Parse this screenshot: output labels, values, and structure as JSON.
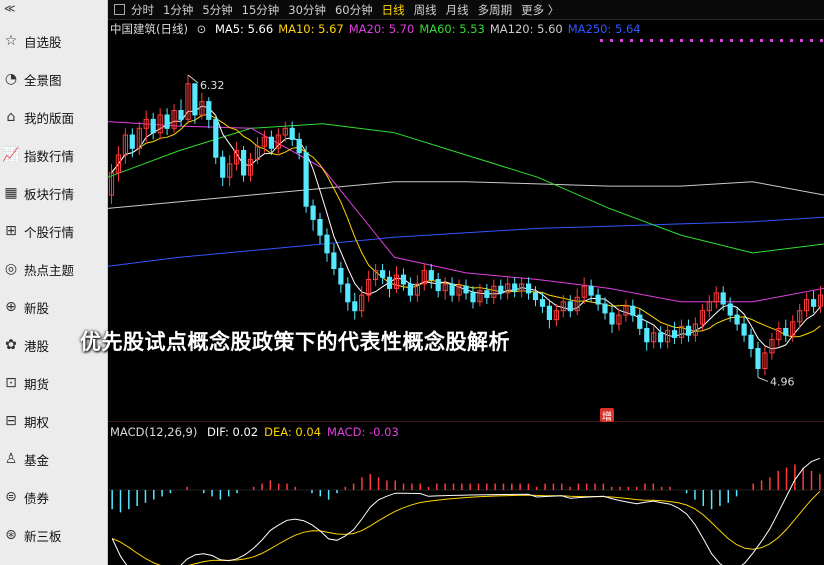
{
  "sidebar": {
    "collapse_icon": "double-chevron-left-icon",
    "items": [
      {
        "label": "自选股",
        "icon": "star-icon"
      },
      {
        "label": "全景图",
        "icon": "pie-chart-icon"
      },
      {
        "label": "我的版面",
        "icon": "home-icon"
      },
      {
        "label": "指数行情",
        "icon": "line-chart-icon"
      },
      {
        "label": "板块行情",
        "icon": "grid-icon"
      },
      {
        "label": "个股行情",
        "icon": "person-chart-icon"
      },
      {
        "label": "热点主题",
        "icon": "target-icon"
      },
      {
        "label": "新股",
        "icon": "new-stock-icon"
      },
      {
        "label": "港股",
        "icon": "bauhinia-icon"
      },
      {
        "label": "期货",
        "icon": "futures-chart-icon"
      },
      {
        "label": "期权",
        "icon": "options-chart-icon"
      },
      {
        "label": "基金",
        "icon": "fund-icon"
      },
      {
        "label": "债券",
        "icon": "bond-icon"
      },
      {
        "label": "新三板",
        "icon": "neeq-icon"
      }
    ]
  },
  "toolbar": {
    "tabs": [
      "分时",
      "1分钟",
      "5分钟",
      "15分钟",
      "30分钟",
      "60分钟",
      "日线",
      "周线",
      "月线",
      "多周期",
      "更多 〉"
    ],
    "active_tab": "日线"
  },
  "legend": {
    "stock": "中国建筑(日线)",
    "items": [
      {
        "text": "MA5: 5.66",
        "color": "#ffffff"
      },
      {
        "text": "MA10: 5.67",
        "color": "#ffd400"
      },
      {
        "text": "MA20: 5.70",
        "color": "#e040e0"
      },
      {
        "text": "MA60: 5.53",
        "color": "#33dd33"
      },
      {
        "text": "MA120: 5.60",
        "color": "#cccccc"
      },
      {
        "text": "MA250: 5.64",
        "color": "#3355ff"
      }
    ]
  },
  "macd_legend": {
    "label": "MACD(12,26,9)",
    "items": [
      {
        "text": "DIF: 0.02",
        "color": "#ffffff"
      },
      {
        "text": "DEA: 0.04",
        "color": "#ffd400"
      },
      {
        "text": "MACD: -0.03",
        "color": "#e040e0"
      }
    ]
  },
  "annotations": {
    "high_label": "6.32",
    "low_label": "4.96",
    "badge": "增"
  },
  "overlay_title": "优先股试点概念股政策下的代表性概念股解析",
  "colors": {
    "up": "#ff3b3b",
    "down": "#55e8ff",
    "background": "#000000",
    "active_tab": "#ffd400"
  },
  "chart_data": {
    "type": "candlestick",
    "ylim": [
      4.8,
      6.45
    ],
    "high": 6.32,
    "low": 4.96,
    "candles": [
      [
        5.78,
        5.88,
        5.74,
        5.92
      ],
      [
        5.88,
        5.96,
        5.84,
        6.0
      ],
      [
        5.96,
        6.05,
        5.92,
        6.08
      ],
      [
        6.05,
        5.99,
        5.95,
        6.08
      ],
      [
        5.99,
        6.08,
        5.96,
        6.11
      ],
      [
        6.08,
        6.12,
        6.02,
        6.16
      ],
      [
        6.12,
        6.06,
        6.03,
        6.15
      ],
      [
        6.06,
        6.14,
        6.03,
        6.17
      ],
      [
        6.14,
        6.08,
        6.05,
        6.17
      ],
      [
        6.08,
        6.16,
        6.06,
        6.19
      ],
      [
        6.16,
        6.12,
        6.09,
        6.21
      ],
      [
        6.12,
        6.28,
        6.1,
        6.32
      ],
      [
        6.28,
        6.14,
        6.1,
        6.28
      ],
      [
        6.14,
        6.2,
        6.12,
        6.24
      ],
      [
        6.2,
        6.12,
        6.08,
        6.22
      ],
      [
        6.12,
        5.95,
        5.92,
        6.14
      ],
      [
        5.95,
        5.86,
        5.82,
        5.98
      ],
      [
        5.86,
        5.92,
        5.82,
        5.96
      ],
      [
        5.92,
        5.98,
        5.89,
        6.02
      ],
      [
        5.98,
        5.87,
        5.84,
        6.0
      ],
      [
        5.87,
        5.94,
        5.84,
        5.97
      ],
      [
        5.94,
        6.0,
        5.92,
        6.04
      ],
      [
        6.0,
        6.04,
        5.97,
        6.07
      ],
      [
        6.04,
        5.99,
        5.96,
        6.07
      ],
      [
        5.99,
        6.05,
        5.96,
        6.08
      ],
      [
        6.05,
        6.08,
        6.02,
        6.11
      ],
      [
        6.08,
        6.03,
        6.0,
        6.11
      ],
      [
        6.03,
        5.97,
        5.94,
        6.06
      ],
      [
        5.97,
        5.73,
        5.7,
        6.0
      ],
      [
        5.73,
        5.67,
        5.62,
        5.76
      ],
      [
        5.67,
        5.6,
        5.56,
        5.7
      ],
      [
        5.6,
        5.52,
        5.48,
        5.63
      ],
      [
        5.52,
        5.45,
        5.42,
        5.56
      ],
      [
        5.45,
        5.38,
        5.34,
        5.48
      ],
      [
        5.38,
        5.3,
        5.26,
        5.41
      ],
      [
        5.3,
        5.26,
        5.22,
        5.34
      ],
      [
        5.26,
        5.33,
        5.23,
        5.37
      ],
      [
        5.33,
        5.4,
        5.3,
        5.44
      ],
      [
        5.4,
        5.44,
        5.37,
        5.47
      ],
      [
        5.44,
        5.41,
        5.38,
        5.47
      ],
      [
        5.41,
        5.36,
        5.32,
        5.44
      ],
      [
        5.36,
        5.42,
        5.34,
        5.46
      ],
      [
        5.42,
        5.38,
        5.35,
        5.45
      ],
      [
        5.38,
        5.33,
        5.3,
        5.41
      ],
      [
        5.33,
        5.38,
        5.3,
        5.42
      ],
      [
        5.38,
        5.44,
        5.35,
        5.47
      ],
      [
        5.44,
        5.4,
        5.36,
        5.47
      ],
      [
        5.4,
        5.35,
        5.32,
        5.43
      ],
      [
        5.35,
        5.38,
        5.31,
        5.41
      ],
      [
        5.38,
        5.33,
        5.3,
        5.41
      ],
      [
        5.33,
        5.37,
        5.3,
        5.4
      ],
      [
        5.37,
        5.34,
        5.31,
        5.4
      ],
      [
        5.34,
        5.3,
        5.27,
        5.37
      ],
      [
        5.3,
        5.35,
        5.28,
        5.38
      ],
      [
        5.35,
        5.32,
        5.29,
        5.38
      ],
      [
        5.32,
        5.37,
        5.29,
        5.4
      ],
      [
        5.37,
        5.34,
        5.31,
        5.4
      ],
      [
        5.34,
        5.38,
        5.31,
        5.41
      ],
      [
        5.38,
        5.35,
        5.32,
        5.41
      ],
      [
        5.35,
        5.38,
        5.32,
        5.41
      ],
      [
        5.38,
        5.34,
        5.31,
        5.41
      ],
      [
        5.34,
        5.31,
        5.28,
        5.37
      ],
      [
        5.31,
        5.28,
        5.25,
        5.34
      ],
      [
        5.28,
        5.22,
        5.18,
        5.31
      ],
      [
        5.22,
        5.26,
        5.19,
        5.29
      ],
      [
        5.26,
        5.3,
        5.23,
        5.33
      ],
      [
        5.3,
        5.26,
        5.23,
        5.33
      ],
      [
        5.26,
        5.32,
        5.24,
        5.36
      ],
      [
        5.32,
        5.37,
        5.29,
        5.41
      ],
      [
        5.37,
        5.33,
        5.3,
        5.4
      ],
      [
        5.33,
        5.29,
        5.26,
        5.36
      ],
      [
        5.29,
        5.25,
        5.22,
        5.32
      ],
      [
        5.25,
        5.2,
        5.16,
        5.28
      ],
      [
        5.2,
        5.24,
        5.17,
        5.27
      ],
      [
        5.24,
        5.28,
        5.21,
        5.31
      ],
      [
        5.28,
        5.24,
        5.21,
        5.31
      ],
      [
        5.24,
        5.18,
        5.15,
        5.27
      ],
      [
        5.18,
        5.12,
        5.08,
        5.21
      ],
      [
        5.12,
        5.16,
        5.09,
        5.19
      ],
      [
        5.16,
        5.12,
        5.09,
        5.19
      ],
      [
        5.12,
        5.17,
        5.09,
        5.2
      ],
      [
        5.17,
        5.14,
        5.11,
        5.21
      ],
      [
        5.14,
        5.19,
        5.11,
        5.22
      ],
      [
        5.19,
        5.15,
        5.12,
        5.22
      ],
      [
        5.15,
        5.2,
        5.12,
        5.23
      ],
      [
        5.2,
        5.26,
        5.17,
        5.29
      ],
      [
        5.26,
        5.3,
        5.23,
        5.33
      ],
      [
        5.3,
        5.34,
        5.27,
        5.37
      ],
      [
        5.34,
        5.29,
        5.26,
        5.37
      ],
      [
        5.29,
        5.24,
        5.21,
        5.32
      ],
      [
        5.24,
        5.2,
        5.17,
        5.27
      ],
      [
        5.2,
        5.15,
        5.12,
        5.23
      ],
      [
        5.15,
        5.09,
        5.05,
        5.18
      ],
      [
        5.09,
        5.0,
        4.96,
        5.12
      ],
      [
        5.0,
        5.07,
        4.97,
        5.1
      ],
      [
        5.07,
        5.13,
        5.04,
        5.16
      ],
      [
        5.13,
        5.18,
        5.1,
        5.21
      ],
      [
        5.18,
        5.15,
        5.12,
        5.22
      ],
      [
        5.15,
        5.21,
        5.12,
        5.24
      ],
      [
        5.21,
        5.26,
        5.18,
        5.29
      ],
      [
        5.26,
        5.31,
        5.23,
        5.34
      ],
      [
        5.31,
        5.28,
        5.25,
        5.35
      ],
      [
        5.28,
        5.33,
        5.25,
        5.37
      ]
    ],
    "ma_lines": [
      {
        "name": "MA250",
        "color": "#3355ff",
        "values": [
          5.46,
          5.5,
          5.53,
          5.56,
          5.59,
          5.61,
          5.63,
          5.64,
          5.65,
          5.66,
          5.68
        ]
      },
      {
        "name": "MA120",
        "color": "#cccccc",
        "values": [
          5.72,
          5.75,
          5.78,
          5.81,
          5.84,
          5.84,
          5.83,
          5.82,
          5.82,
          5.84,
          5.78
        ]
      },
      {
        "name": "MA60",
        "color": "#33dd33",
        "values": [
          5.86,
          5.98,
          6.08,
          6.1,
          6.06,
          5.96,
          5.86,
          5.72,
          5.6,
          5.52,
          5.56
        ]
      },
      {
        "name": "MA20",
        "color": "#e040e0",
        "values": [
          6.11,
          6.09,
          6.08,
          5.9,
          5.5,
          5.43,
          5.4,
          5.36,
          5.3,
          5.3,
          5.36
        ]
      }
    ],
    "macd_bars": [
      -0.06,
      -0.07,
      -0.06,
      -0.05,
      -0.04,
      -0.03,
      -0.02,
      -0.01,
      0.0,
      0.01,
      0.0,
      -0.01,
      -0.02,
      -0.03,
      -0.02,
      -0.01,
      0.0,
      0.01,
      0.02,
      0.03,
      0.02,
      0.02,
      0.01,
      0.0,
      -0.01,
      -0.02,
      -0.03,
      -0.01,
      0.01,
      0.02,
      0.04,
      0.05,
      0.04,
      0.03,
      0.03,
      0.02,
      0.02,
      0.02,
      0.01,
      0.02,
      0.02,
      0.02,
      0.02,
      0.02,
      0.02,
      0.02,
      0.02,
      0.02,
      0.02,
      0.02,
      0.02,
      0.01,
      0.02,
      0.02,
      0.02,
      0.01,
      0.02,
      0.02,
      0.02,
      0.02,
      0.01,
      0.01,
      0.01,
      0.01,
      0.02,
      0.02,
      0.01,
      0.01,
      0.0,
      -0.01,
      -0.03,
      -0.05,
      -0.06,
      -0.05,
      -0.04,
      -0.02,
      0.0,
      0.02,
      0.03,
      0.04,
      0.06,
      0.07,
      0.08,
      0.07,
      0.06,
      0.05
    ]
  }
}
